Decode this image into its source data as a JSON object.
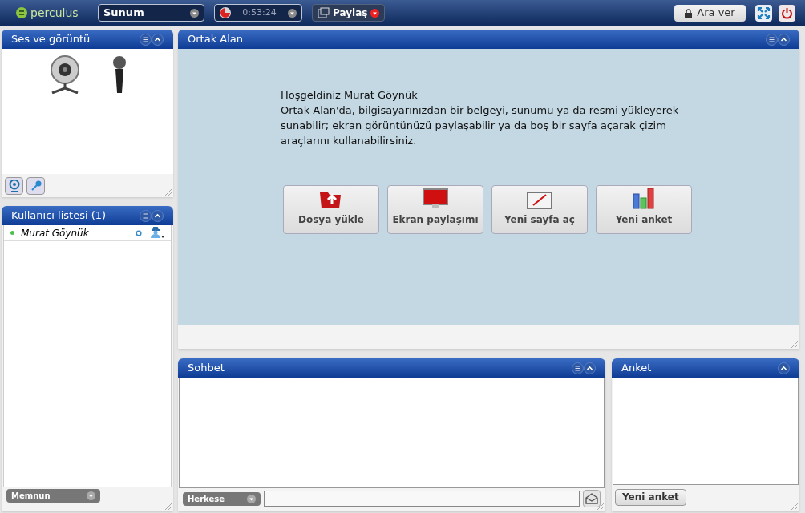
{
  "top_bar": {
    "logo": "perculus",
    "mode_select": "Sunum",
    "timer": "0:53:24",
    "share_button": "Paylaş",
    "break_button": "Ara ver"
  },
  "av_panel": {
    "title": "Ses ve görüntü",
    "has_menu": true
  },
  "user_panel": {
    "title": "Kullanıcı listesi (1)",
    "has_menu": true,
    "users": [
      {
        "name": "Murat Göynük",
        "online": true
      }
    ],
    "mood_select": "Memnun"
  },
  "shared_area": {
    "title": "Ortak Alan",
    "has_menu": true,
    "welcome": "Hoşgeldiniz Murat Göynük",
    "description": "Ortak Alan'da, bilgisayarınızdan bir belgeyi, sunumu ya da resmi yükleyerek sunabilir; ekran görüntünüzü paylaşabilir ya da boş bir sayfa açarak çizim araçlarını kullanabilirsiniz.",
    "actions": [
      {
        "kind": "upload",
        "label": "Dosya yükle"
      },
      {
        "kind": "screen",
        "label": "Ekran paylaşımı"
      },
      {
        "kind": "page",
        "label": "Yeni sayfa aç"
      },
      {
        "kind": "poll",
        "label": "Yeni anket"
      }
    ]
  },
  "chat": {
    "title": "Sohbet",
    "has_menu": true,
    "recipient_select": "Herkese"
  },
  "poll": {
    "title": "Anket",
    "has_menu": false,
    "new_poll_button": "Yeni anket"
  }
}
